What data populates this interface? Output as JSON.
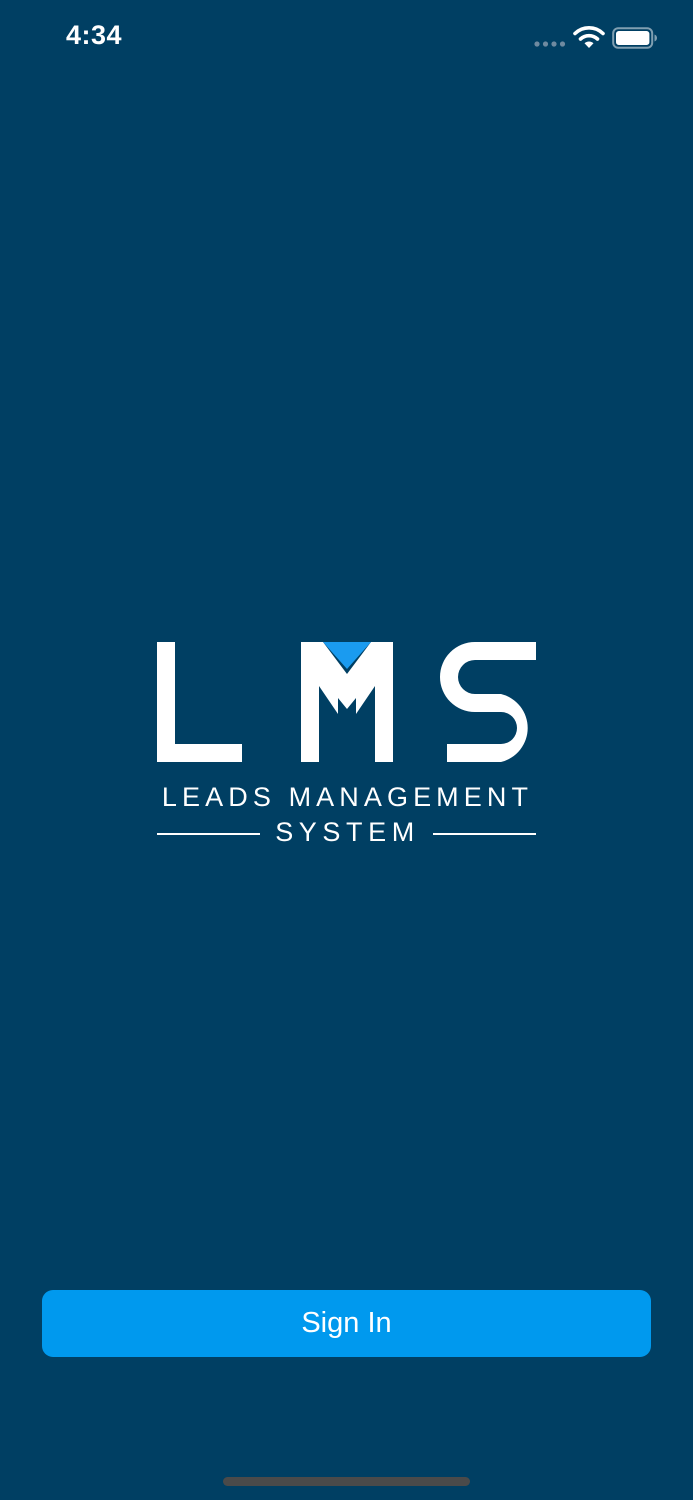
{
  "status_bar": {
    "time": "4:34",
    "icons": [
      "signal-dots-icon",
      "wifi-icon",
      "battery-icon"
    ]
  },
  "logo": {
    "letters": "LMS",
    "line1": "LEADS MANAGEMENT",
    "line2": "SYSTEM",
    "accent_color": "#1a9bf0"
  },
  "sign_in": {
    "label": "Sign In"
  },
  "colors": {
    "background": "#003f63",
    "button": "#0099ee",
    "text": "#ffffff"
  }
}
